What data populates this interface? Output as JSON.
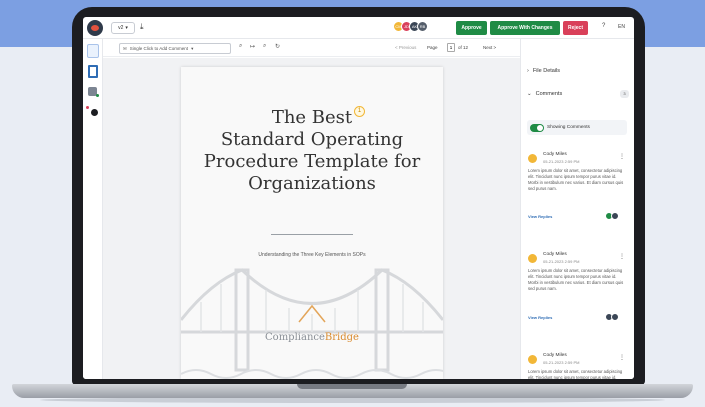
{
  "topbar": {
    "version": "v2",
    "download_icon": "download-icon",
    "avatars": [
      "CM",
      "JD",
      "AK",
      "RB"
    ],
    "approve": "Approve",
    "approve_with_changes": "Approve With Changes",
    "reject": "Reject",
    "help": "?",
    "language": "EN"
  },
  "doc_toolbar": {
    "comment_mode": "Single Click to Add Comment",
    "previous": "< Previous",
    "page_label": "Page",
    "page_current": "1",
    "page_total": "of 12",
    "next": "Next >"
  },
  "document": {
    "title_lines": [
      "The Best",
      "Standard Operating",
      "Procedure Template for",
      "Organizations"
    ],
    "comment_marker": "1",
    "subtitle": "Understanding the Three Key Elements in SOPs",
    "brand_prefix": "Compliance",
    "brand_suffix": "Bridge"
  },
  "panel": {
    "file_details": "File Details",
    "comments": "Comments",
    "comment_count": "3",
    "showing_comments": "Showing Comments",
    "comments_list": [
      {
        "author": "Cody Miles",
        "date": "05-21-2023 2:59 PM",
        "text": "Lorem ipsum dolor sit amet, consectetur adipiscing elit. Tincidunt nunc ipsum tempor purus vitae id. Morbi in vestibulum nec varius. Et diam cursus quis sed purus nam.",
        "replies": "View Replies"
      },
      {
        "author": "Cody Miles",
        "date": "05-21-2023 2:59 PM",
        "text": "Lorem ipsum dolor sit amet, consectetur adipiscing elit. Tincidunt nunc ipsum tempor purus vitae id. Morbi in vestibulum nec varius. Et diam cursus quis sed purus nam.",
        "replies": "View Replies"
      },
      {
        "author": "Cody Miles",
        "date": "05-21-2023 2:59 PM",
        "text": "Lorem ipsum dolor sit amet, consectetur adipiscing elit. Tincidunt nunc ipsum tempor purus vitae id.",
        "replies": ""
      }
    ]
  },
  "colors": {
    "approve": "#1f8b45",
    "reject": "#d9405a",
    "accent": "#2f6db5",
    "marker": "#f2b737",
    "band": "#7c9fe2"
  }
}
